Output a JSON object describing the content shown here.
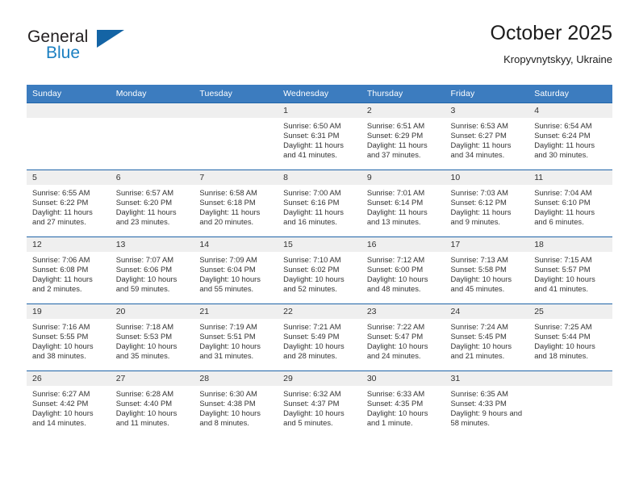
{
  "brand": {
    "word_one": "General",
    "word_two": "Blue",
    "logo_icon": "triangle-logo-icon"
  },
  "header": {
    "title": "October 2025",
    "subtitle": "Kropyvnytskyy, Ukraine"
  },
  "colors": {
    "header_blue": "#3c7cbf",
    "row_rule_blue": "#1f64a8",
    "daynum_bg": "#efefef",
    "brand_blue": "#1a7fc1",
    "text": "#333333"
  },
  "weekdays": [
    "Sunday",
    "Monday",
    "Tuesday",
    "Wednesday",
    "Thursday",
    "Friday",
    "Saturday"
  ],
  "labels": {
    "sunrise": "Sunrise:",
    "sunset": "Sunset:",
    "daylight": "Daylight:"
  },
  "weeks": [
    [
      {
        "day": "",
        "sunrise": "",
        "sunset": "",
        "daylight": ""
      },
      {
        "day": "",
        "sunrise": "",
        "sunset": "",
        "daylight": ""
      },
      {
        "day": "",
        "sunrise": "",
        "sunset": "",
        "daylight": ""
      },
      {
        "day": "1",
        "sunrise": "Sunrise: 6:50 AM",
        "sunset": "Sunset: 6:31 PM",
        "daylight": "Daylight: 11 hours and 41 minutes."
      },
      {
        "day": "2",
        "sunrise": "Sunrise: 6:51 AM",
        "sunset": "Sunset: 6:29 PM",
        "daylight": "Daylight: 11 hours and 37 minutes."
      },
      {
        "day": "3",
        "sunrise": "Sunrise: 6:53 AM",
        "sunset": "Sunset: 6:27 PM",
        "daylight": "Daylight: 11 hours and 34 minutes."
      },
      {
        "day": "4",
        "sunrise": "Sunrise: 6:54 AM",
        "sunset": "Sunset: 6:24 PM",
        "daylight": "Daylight: 11 hours and 30 minutes."
      }
    ],
    [
      {
        "day": "5",
        "sunrise": "Sunrise: 6:55 AM",
        "sunset": "Sunset: 6:22 PM",
        "daylight": "Daylight: 11 hours and 27 minutes."
      },
      {
        "day": "6",
        "sunrise": "Sunrise: 6:57 AM",
        "sunset": "Sunset: 6:20 PM",
        "daylight": "Daylight: 11 hours and 23 minutes."
      },
      {
        "day": "7",
        "sunrise": "Sunrise: 6:58 AM",
        "sunset": "Sunset: 6:18 PM",
        "daylight": "Daylight: 11 hours and 20 minutes."
      },
      {
        "day": "8",
        "sunrise": "Sunrise: 7:00 AM",
        "sunset": "Sunset: 6:16 PM",
        "daylight": "Daylight: 11 hours and 16 minutes."
      },
      {
        "day": "9",
        "sunrise": "Sunrise: 7:01 AM",
        "sunset": "Sunset: 6:14 PM",
        "daylight": "Daylight: 11 hours and 13 minutes."
      },
      {
        "day": "10",
        "sunrise": "Sunrise: 7:03 AM",
        "sunset": "Sunset: 6:12 PM",
        "daylight": "Daylight: 11 hours and 9 minutes."
      },
      {
        "day": "11",
        "sunrise": "Sunrise: 7:04 AM",
        "sunset": "Sunset: 6:10 PM",
        "daylight": "Daylight: 11 hours and 6 minutes."
      }
    ],
    [
      {
        "day": "12",
        "sunrise": "Sunrise: 7:06 AM",
        "sunset": "Sunset: 6:08 PM",
        "daylight": "Daylight: 11 hours and 2 minutes."
      },
      {
        "day": "13",
        "sunrise": "Sunrise: 7:07 AM",
        "sunset": "Sunset: 6:06 PM",
        "daylight": "Daylight: 10 hours and 59 minutes."
      },
      {
        "day": "14",
        "sunrise": "Sunrise: 7:09 AM",
        "sunset": "Sunset: 6:04 PM",
        "daylight": "Daylight: 10 hours and 55 minutes."
      },
      {
        "day": "15",
        "sunrise": "Sunrise: 7:10 AM",
        "sunset": "Sunset: 6:02 PM",
        "daylight": "Daylight: 10 hours and 52 minutes."
      },
      {
        "day": "16",
        "sunrise": "Sunrise: 7:12 AM",
        "sunset": "Sunset: 6:00 PM",
        "daylight": "Daylight: 10 hours and 48 minutes."
      },
      {
        "day": "17",
        "sunrise": "Sunrise: 7:13 AM",
        "sunset": "Sunset: 5:58 PM",
        "daylight": "Daylight: 10 hours and 45 minutes."
      },
      {
        "day": "18",
        "sunrise": "Sunrise: 7:15 AM",
        "sunset": "Sunset: 5:57 PM",
        "daylight": "Daylight: 10 hours and 41 minutes."
      }
    ],
    [
      {
        "day": "19",
        "sunrise": "Sunrise: 7:16 AM",
        "sunset": "Sunset: 5:55 PM",
        "daylight": "Daylight: 10 hours and 38 minutes."
      },
      {
        "day": "20",
        "sunrise": "Sunrise: 7:18 AM",
        "sunset": "Sunset: 5:53 PM",
        "daylight": "Daylight: 10 hours and 35 minutes."
      },
      {
        "day": "21",
        "sunrise": "Sunrise: 7:19 AM",
        "sunset": "Sunset: 5:51 PM",
        "daylight": "Daylight: 10 hours and 31 minutes."
      },
      {
        "day": "22",
        "sunrise": "Sunrise: 7:21 AM",
        "sunset": "Sunset: 5:49 PM",
        "daylight": "Daylight: 10 hours and 28 minutes."
      },
      {
        "day": "23",
        "sunrise": "Sunrise: 7:22 AM",
        "sunset": "Sunset: 5:47 PM",
        "daylight": "Daylight: 10 hours and 24 minutes."
      },
      {
        "day": "24",
        "sunrise": "Sunrise: 7:24 AM",
        "sunset": "Sunset: 5:45 PM",
        "daylight": "Daylight: 10 hours and 21 minutes."
      },
      {
        "day": "25",
        "sunrise": "Sunrise: 7:25 AM",
        "sunset": "Sunset: 5:44 PM",
        "daylight": "Daylight: 10 hours and 18 minutes."
      }
    ],
    [
      {
        "day": "26",
        "sunrise": "Sunrise: 6:27 AM",
        "sunset": "Sunset: 4:42 PM",
        "daylight": "Daylight: 10 hours and 14 minutes."
      },
      {
        "day": "27",
        "sunrise": "Sunrise: 6:28 AM",
        "sunset": "Sunset: 4:40 PM",
        "daylight": "Daylight: 10 hours and 11 minutes."
      },
      {
        "day": "28",
        "sunrise": "Sunrise: 6:30 AM",
        "sunset": "Sunset: 4:38 PM",
        "daylight": "Daylight: 10 hours and 8 minutes."
      },
      {
        "day": "29",
        "sunrise": "Sunrise: 6:32 AM",
        "sunset": "Sunset: 4:37 PM",
        "daylight": "Daylight: 10 hours and 5 minutes."
      },
      {
        "day": "30",
        "sunrise": "Sunrise: 6:33 AM",
        "sunset": "Sunset: 4:35 PM",
        "daylight": "Daylight: 10 hours and 1 minute."
      },
      {
        "day": "31",
        "sunrise": "Sunrise: 6:35 AM",
        "sunset": "Sunset: 4:33 PM",
        "daylight": "Daylight: 9 hours and 58 minutes."
      },
      {
        "day": "",
        "sunrise": "",
        "sunset": "",
        "daylight": ""
      }
    ]
  ]
}
